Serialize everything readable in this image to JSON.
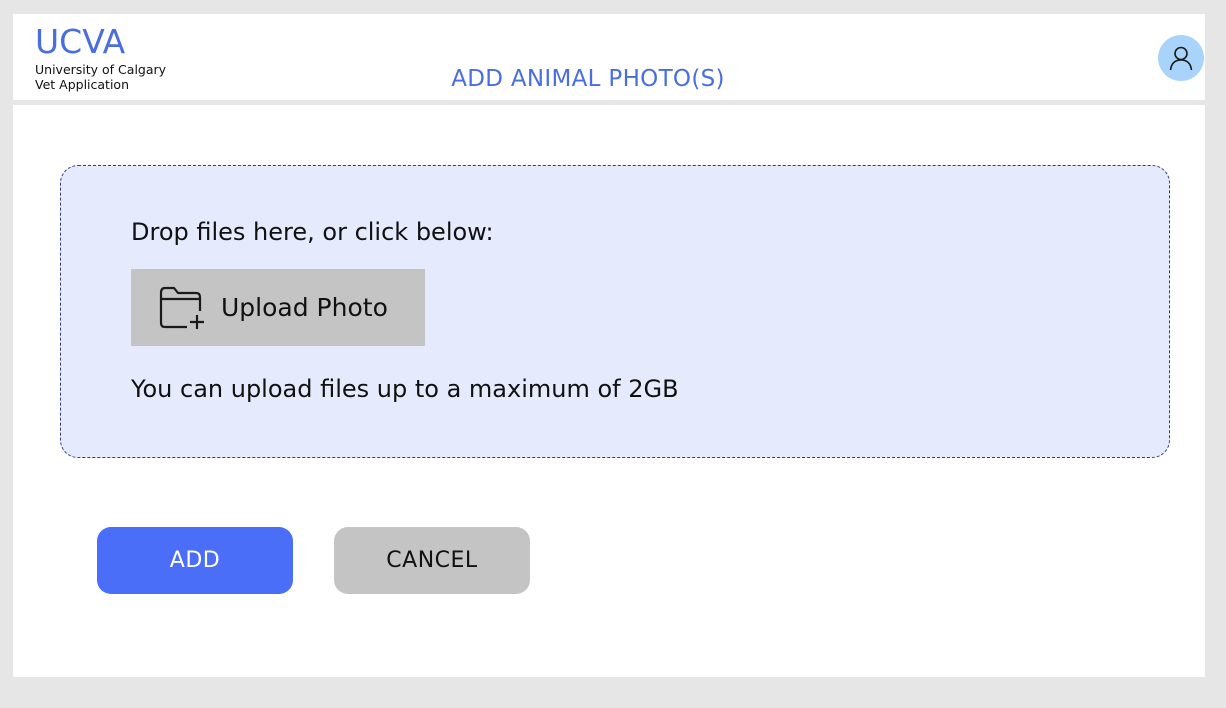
{
  "header": {
    "logo_title": "UCVA",
    "logo_line1": "University of Calgary",
    "logo_line2": "Vet Application",
    "page_title": "ADD ANIMAL PHOTO(S)",
    "avatar_icon": "user-icon"
  },
  "dropzone": {
    "instruction": "Drop files here, or click below:",
    "upload_label": "Upload Photo",
    "upload_icon": "folder-add-icon",
    "limit_text": "You can upload files up to a maximum of 2GB"
  },
  "actions": {
    "add_label": "ADD",
    "cancel_label": "CANCEL"
  },
  "colors": {
    "brand": "#4a6ee0",
    "primary_button": "#4a6ef7",
    "secondary_button": "#c4c4c4",
    "dropzone_bg": "#e5eafd",
    "avatar_bg": "#a8d4fb"
  }
}
